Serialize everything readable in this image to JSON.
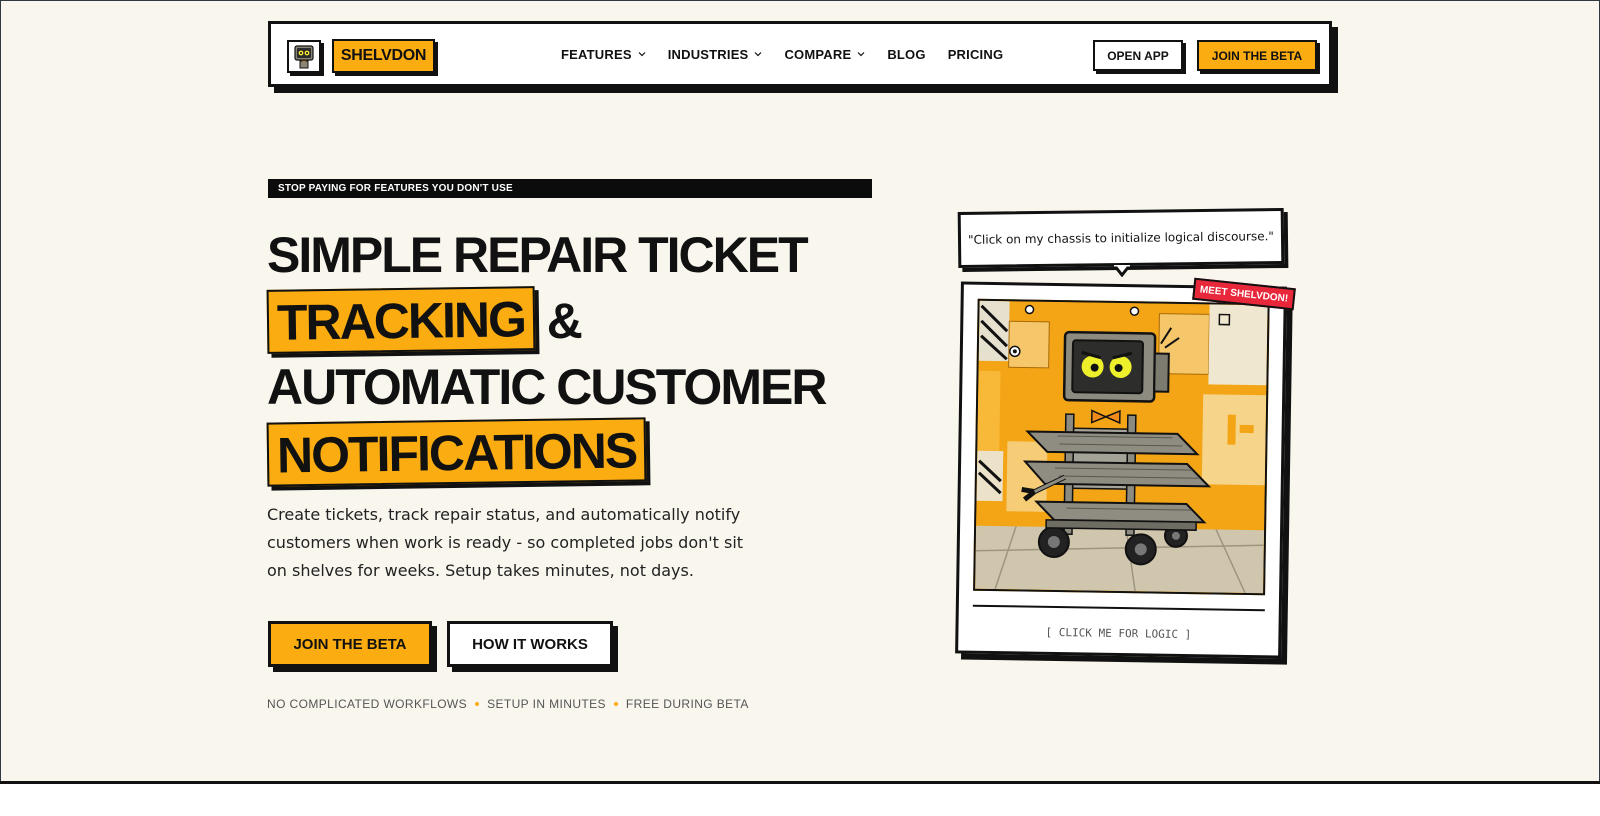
{
  "nav": {
    "brand": "SHELVDON",
    "menu": [
      {
        "label": "FEATURES",
        "has_dropdown": true
      },
      {
        "label": "INDUSTRIES",
        "has_dropdown": true
      },
      {
        "label": "COMPARE",
        "has_dropdown": true
      },
      {
        "label": "BLOG",
        "has_dropdown": false
      },
      {
        "label": "PRICING",
        "has_dropdown": false
      }
    ],
    "open_app": "OPEN APP",
    "join_beta": "JOIN THE BETA"
  },
  "hero": {
    "eyebrow": "STOP PAYING FOR FEATURES YOU DON'T USE",
    "headline": {
      "line1": "SIMPLE REPAIR TICKET",
      "line2_mark": "TRACKING",
      "line2_rest": "&",
      "line3": "AUTOMATIC CUSTOMER",
      "line4_mark": "NOTIFICATIONS"
    },
    "description": "Create tickets, track repair status, and automatically notify customers when work is ready - so completed jobs don't sit on shelves for weeks. Setup takes minutes, not days.",
    "cta_primary": "JOIN THE BETA",
    "cta_secondary": "HOW IT WORKS",
    "perks": [
      "NO COMPLICATED WORKFLOWS",
      "SETUP IN MINUTES",
      "FREE DURING BETA"
    ]
  },
  "mascot": {
    "speech": "\"Click on my chassis to initialize logical discourse.\"",
    "tag": "MEET SHELVDON!",
    "caption": "[ CLICK ME FOR LOGIC ]"
  },
  "colors": {
    "accent": "#fbac10",
    "background": "#f9f6ee",
    "ink": "#111111",
    "tag_red": "#e8273b"
  }
}
